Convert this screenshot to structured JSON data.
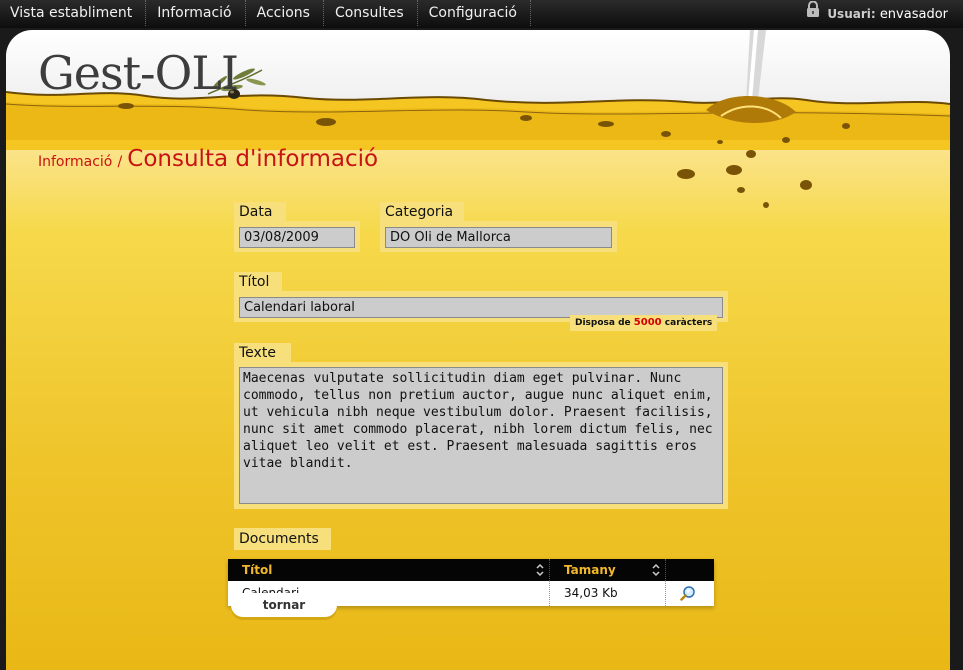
{
  "nav": {
    "items": [
      "Vista establiment",
      "Informació",
      "Accions",
      "Consultes",
      "Configuració"
    ]
  },
  "user": {
    "label": "Usuari:",
    "name": "envasador"
  },
  "logo": {
    "text": "Gest-OLI"
  },
  "breadcrumb": {
    "parent": "Informació",
    "separator": "/",
    "current": "Consulta d'informació"
  },
  "form": {
    "date_label": "Data",
    "date_value": "03/08/2009",
    "category_label": "Categoria",
    "category_value": "DO Oli de Mallorca",
    "title_label": "Títol",
    "title_value": "Calendari laboral",
    "text_label": "Texte",
    "counter_prefix": "Disposa de",
    "counter_value": "5000",
    "counter_suffix": "caràcters",
    "text_value": "Maecenas vulputate sollicitudin diam eget pulvinar. Nunc commodo, tellus non pretium auctor, augue nunc aliquet enim, ut vehicula nibh neque vestibulum dolor. Praesent facilisis, nunc sit amet commodo placerat, nibh lorem dictum felis, nec aliquet leo velit et est. Praesent malesuada sagittis eros vitae blandit."
  },
  "documents": {
    "label": "Documents",
    "headers": [
      "Títol",
      "Tamany"
    ],
    "rows": [
      {
        "title": "Calendari",
        "size": "34,03 Kb"
      }
    ]
  },
  "buttons": {
    "back": "tornar"
  },
  "colors": {
    "accent_red": "#c81313",
    "header_gold": "#f2b82a",
    "label_bg": "#f7e07c"
  }
}
